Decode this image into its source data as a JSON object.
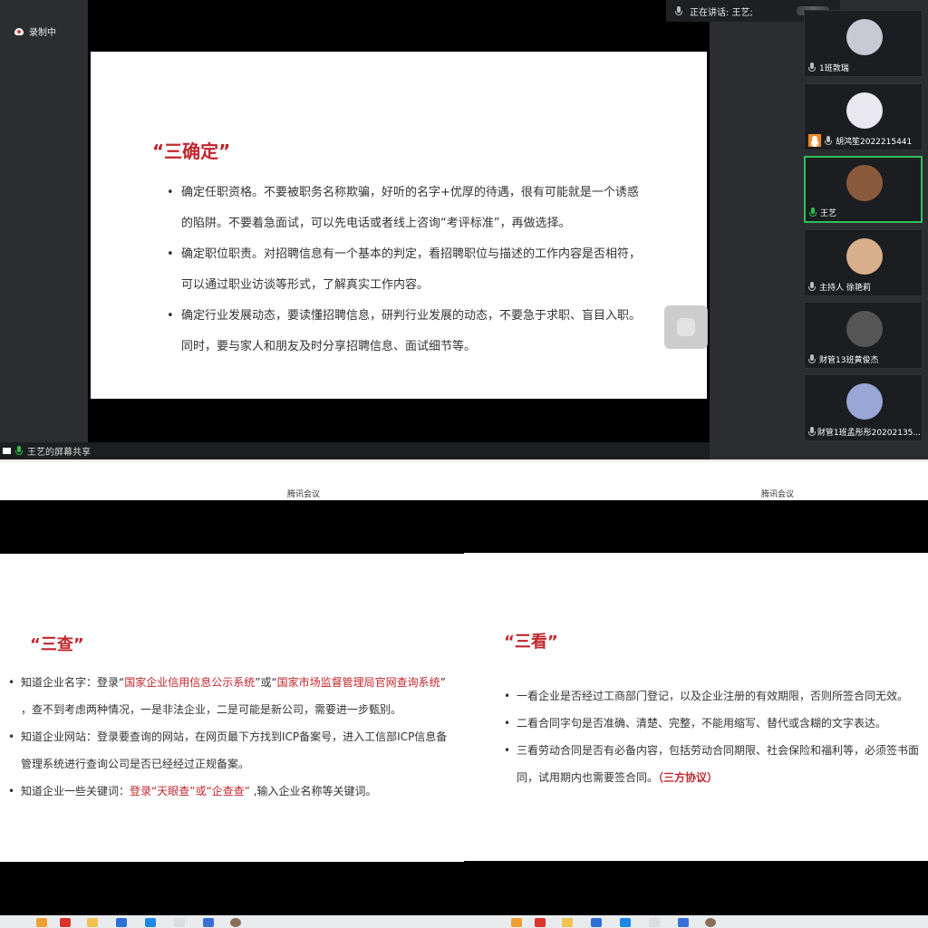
{
  "recording": {
    "label": "录制中"
  },
  "share": {
    "label": "王艺的屏幕共享"
  },
  "speaking": {
    "label": "正在讲话: 王艺;"
  },
  "slide_top": {
    "title": "“三确定”",
    "bullets": [
      {
        "line1": "确定任职资格。不要被职务名称欺骗，好听的名字+优厚的待遇，很有可能就是一个诱惑",
        "line2": "的陷阱。不要着急面试，可以先电话或者线上咨询“考评标准”，再做选择。"
      },
      {
        "line1": "确定职位职责。对招聘信息有一个基本的判定，看招聘职位与描述的工作内容是否相符，",
        "line2": "可以通过职业访谈等形式，了解真实工作内容。"
      },
      {
        "line1": "确定行业发展动态，要读懂招聘信息，研判行业发展的动态，不要急于求职、盲目入职。",
        "line2": "同时，要与家人和朋友及时分享招聘信息、面试细节等。"
      }
    ]
  },
  "participants": [
    {
      "name": "1班敦瑞",
      "avatar_color": "#c9c9d6"
    },
    {
      "name": "胡鸿笙2022215441",
      "avatar_color": "#e8e8ee"
    },
    {
      "name": "王艺",
      "avatar_color": "#8b5a3c"
    },
    {
      "name": "主持人 徐艳莉",
      "avatar_color": "#d9b08c"
    },
    {
      "name": "财管13班黄俊杰",
      "avatar_color": "#555555"
    },
    {
      "name": "财管1班孟彤彤20202135...",
      "avatar_color": "#9aa6d6"
    }
  ],
  "panel_left": {
    "app_title": "腾讯会议",
    "title": "“三查”",
    "items": [
      {
        "a": "知道企业名字：登录“",
        "b": "国家企业信用信息公示系统",
        "c": "”或“",
        "d": "国家市场监督管理局官网查询系统",
        "e": "”"
      },
      {
        "a": "，查不到考虑两种情况，一是非法企业，二是可能是新公司，需要进一步甄别。"
      },
      {
        "a": "知道企业网站：登录要查询的网站，在网页最下方找到ICP备案号，进入工信部ICP信息备"
      },
      {
        "a": "管理系统进行查询公司是否已经经过正规备案。"
      },
      {
        "a": "知道企业一些关键词：",
        "b": "登录“天眼查”或“企查查”",
        "c": " ,输入企业名称等关键词。"
      }
    ]
  },
  "panel_right": {
    "app_title": "腾讯会议",
    "title": "“三看”",
    "items": [
      {
        "a": "一看企业是否经过工商部门登记，以及企业注册的有效期限，否则所签合同无效。"
      },
      {
        "a": "二看合同字句是否准确、清楚、完整，不能用缩写、替代或含糊的文字表达。"
      },
      {
        "a": "三看劳动合同是否有必备内容，包括劳动合同期限、社会保险和福利等，必须签书面"
      },
      {
        "a": "同，试用期内也需要签合同。",
        "b": "（三方协议）"
      }
    ]
  }
}
